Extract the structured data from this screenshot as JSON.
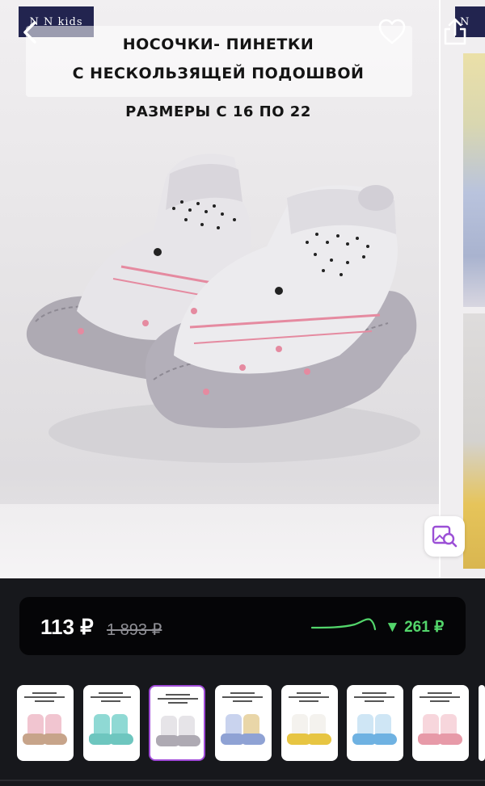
{
  "gallery": {
    "brand_logo_text": "N N kids",
    "brand_logo_next_text": "N",
    "title_line1": "НОСОЧКИ- ПИНЕТКИ",
    "title_line2": "С НЕСКОЛЬЗЯЩЕЙ ПОДОШВОЙ",
    "title_line3": "РАЗМЕРЫ С 16 ПО 22",
    "icons": {
      "back": "chevron-left-icon",
      "favorite": "heart-icon",
      "share": "share-icon",
      "visual_search": "image-search-icon"
    }
  },
  "price": {
    "current": "113 ₽",
    "old": "1 893 ₽",
    "drop": "▼ 261 ₽",
    "drop_color": "#53d66b"
  },
  "thumbnails": {
    "count": 8,
    "selected_index": 2,
    "selected_color": "#a04ad8"
  },
  "colors": {
    "background": "#17181c",
    "panel": "#050507",
    "logo": "#22244f"
  }
}
